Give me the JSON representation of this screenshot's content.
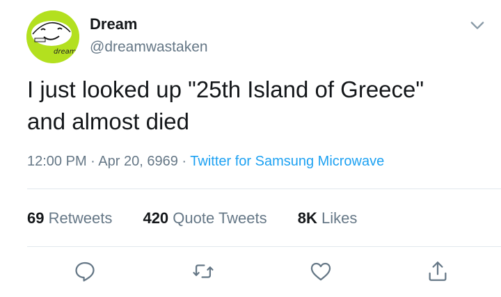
{
  "author": {
    "display_name": "Dream",
    "handle": "@dreamwastaken",
    "avatar_text": "dream",
    "avatar_color": "#b3e01f"
  },
  "tweet": {
    "text": "I just looked up \"25th Island of Greece\"\nand almost died"
  },
  "meta": {
    "time": "12:00 PM",
    "separator": "·",
    "date": "Apr 20, 6969",
    "source": "Twitter for Samsung Microwave"
  },
  "stats": {
    "retweets_count": "69",
    "retweets_label": "Retweets",
    "quote_count": "420",
    "quote_label": "Quote Tweets",
    "likes_count": "8K",
    "likes_label": "Likes"
  },
  "icons": {
    "menu": "chevron-down-icon",
    "reply": "reply-icon",
    "retweet": "retweet-icon",
    "like": "heart-icon",
    "share": "share-icon"
  },
  "colors": {
    "link": "#1da1f2",
    "secondary_text": "#657786",
    "divider": "#e1e8ed"
  }
}
